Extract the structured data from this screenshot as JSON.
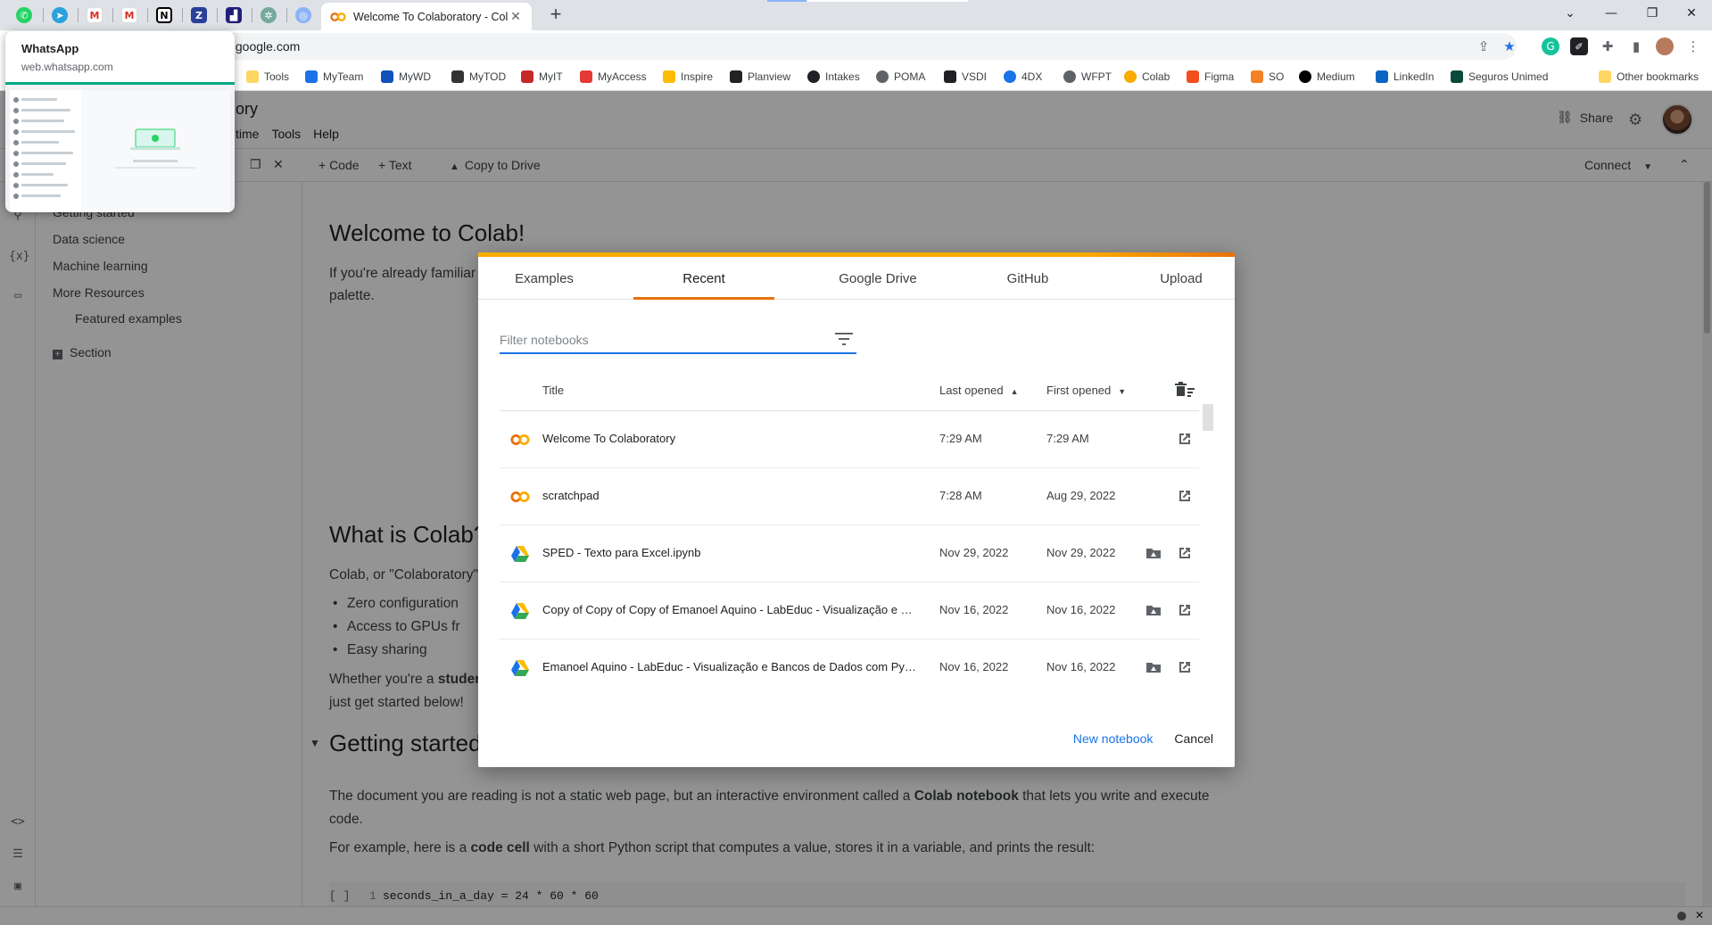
{
  "browser": {
    "active_tab_title": "Welcome To Colaboratory - Colab",
    "address": ".google.com",
    "pinned_tabs": [
      "whatsapp-icon",
      "telegram-icon",
      "gmail-icon",
      "gmail-icon",
      "notion-icon",
      "app-icon",
      "app-icon",
      "chatgpt-icon",
      "app-icon"
    ],
    "hover_card": {
      "title": "WhatsApp",
      "url": "web.whatsapp.com"
    },
    "bookmarks": [
      "Tools",
      "MyTeam",
      "MyWD",
      "MyTOD",
      "MyIT",
      "MyAccess",
      "Inspire",
      "Planview",
      "Intakes",
      "POMA",
      "VSDI",
      "4DX",
      "WFPT",
      "Colab",
      "Figma",
      "SO",
      "Medium",
      "LinkedIn",
      "Seguros Unimed"
    ],
    "other_bookmarks": "Other bookmarks"
  },
  "colab": {
    "title": "ory",
    "menu": [
      "time",
      "Tools",
      "Help"
    ],
    "share_label": "Share",
    "toolbar": {
      "code": "+ Code",
      "text": "+ Text",
      "copy": "Copy to Drive",
      "connect": "Connect"
    },
    "toc": [
      "Getting started",
      "Data science",
      "Machine learning",
      "More Resources",
      "Featured examples",
      "Section"
    ],
    "content": {
      "h_welcome": "Welcome to Colab!",
      "p_intro_1": "If you're already familiar",
      "p_intro_2": "palette.",
      "h_what": "What is Colab?",
      "p_colab": "Colab, or \"Colaboratory\"",
      "bullets": [
        "Zero configuration",
        "Access to GPUs fr",
        "Easy sharing"
      ],
      "p_whether_1": "Whether you're a ",
      "p_whether_bold": "studen",
      "p_whether_2": "just get started below!",
      "h_getting": "Getting started",
      "p_doc_1": "The document you are reading is not a static web page, but an interactive environment called a ",
      "p_doc_bold": "Colab notebook",
      "p_doc_2": " that lets you write and execute",
      "p_doc_3": "code.",
      "p_example_1": "For example, here is a ",
      "p_example_bold": "code cell",
      "p_example_2": " with a short Python script that computes a value, stores it in a variable, and prints the result:",
      "code_prompt": "[ ]",
      "code_line_no": "1",
      "code": "seconds_in_a_day = 24 * 60 * 60"
    }
  },
  "dialog": {
    "tabs": [
      "Examples",
      "Recent",
      "Google Drive",
      "GitHub",
      "Upload"
    ],
    "active_tab": "Recent",
    "filter_placeholder": "Filter notebooks",
    "columns": {
      "title": "Title",
      "last_opened": "Last opened",
      "first_opened": "First opened"
    },
    "rows": [
      {
        "icon": "colab-icon",
        "title": "Welcome To Colaboratory",
        "last": "7:29 AM",
        "first": "7:29 AM",
        "drive": false
      },
      {
        "icon": "colab-icon",
        "title": "scratchpad",
        "last": "7:28 AM",
        "first": "Aug 29, 2022",
        "drive": false
      },
      {
        "icon": "google-drive-icon",
        "title": "SPED - Texto para Excel.ipynb",
        "last": "Nov 29, 2022",
        "first": "Nov 29, 2022",
        "drive": true
      },
      {
        "icon": "google-drive-icon",
        "title": "Copy of Copy of Copy of Emanoel Aquino - LabEduc - Visualização e Ba...",
        "last": "Nov 16, 2022",
        "first": "Nov 16, 2022",
        "drive": true
      },
      {
        "icon": "google-drive-icon",
        "title": "Emanoel Aquino - LabEduc - Visualização e Bancos de Dados com Pyth...",
        "last": "Nov 16, 2022",
        "first": "Nov 16, 2022",
        "drive": true
      }
    ],
    "new_notebook": "New notebook",
    "cancel": "Cancel"
  },
  "colors": {
    "accent_blue": "#1a73e8",
    "colab_orange": "#e8710a",
    "colab_yellow": "#f9ab00"
  }
}
